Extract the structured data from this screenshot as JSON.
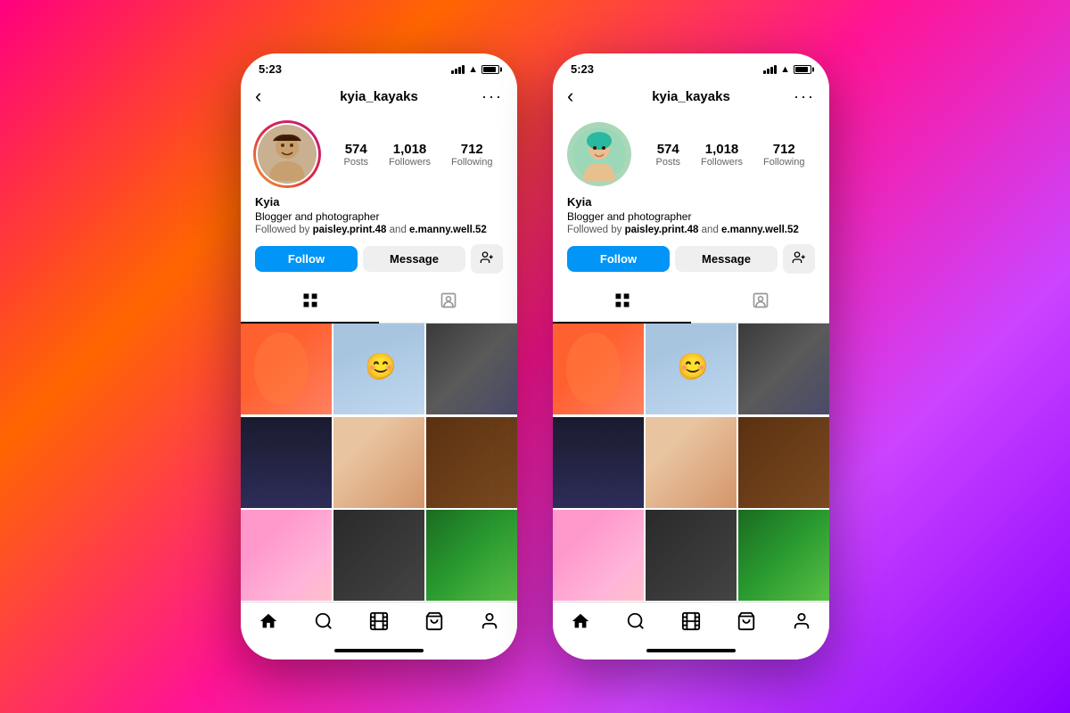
{
  "background": {
    "gradient": "linear-gradient(135deg, #ff0080, #ff6600, #ff1493, #cc44ff, #8800ff)"
  },
  "phones": [
    {
      "id": "phone-1",
      "statusBar": {
        "time": "5:23",
        "hasSignal": true,
        "hasWifi": true,
        "hasBattery": true
      },
      "header": {
        "backLabel": "‹",
        "username": "kyia_kayaks",
        "moreLabel": "···"
      },
      "profile": {
        "name": "Kyia",
        "bio": "Blogger and photographer",
        "followed": "Followed by paisley.print.48 and e.manny.well.52",
        "followedBold1": "paisley.print.48",
        "followedBold2": "e.manny.well.52",
        "stats": [
          {
            "number": "574",
            "label": "Posts"
          },
          {
            "number": "1,018",
            "label": "Followers"
          },
          {
            "number": "712",
            "label": "Following"
          }
        ],
        "avatarType": "real"
      },
      "buttons": {
        "follow": "Follow",
        "message": "Message",
        "addUser": "👤+"
      },
      "tabs": {
        "grid": "⊞",
        "tagged": "👤"
      },
      "photos": [
        "p1",
        "p2",
        "p3",
        "p4",
        "p5",
        "p6",
        "p7",
        "p8",
        "p9"
      ],
      "bottomNav": [
        "🏠",
        "🔍",
        "🎬",
        "🛍",
        "👤"
      ]
    },
    {
      "id": "phone-2",
      "statusBar": {
        "time": "5:23",
        "hasSignal": true,
        "hasWifi": true,
        "hasBattery": true
      },
      "header": {
        "backLabel": "‹",
        "username": "kyia_kayaks",
        "moreLabel": "···"
      },
      "profile": {
        "name": "Kyia",
        "bio": "Blogger and photographer",
        "followed": "Followed by paisley.print.48 and e.manny.well.52",
        "followedBold1": "paisley.print.48",
        "followedBold2": "e.manny.well.52",
        "stats": [
          {
            "number": "574",
            "label": "Posts"
          },
          {
            "number": "1,018",
            "label": "Followers"
          },
          {
            "number": "712",
            "label": "Following"
          }
        ],
        "avatarType": "cartoon"
      },
      "buttons": {
        "follow": "Follow",
        "message": "Message",
        "addUser": "👤+"
      },
      "tabs": {
        "grid": "⊞",
        "tagged": "👤"
      },
      "photos": [
        "p1",
        "p2",
        "p3",
        "p4",
        "p5",
        "p6",
        "p7",
        "p8",
        "p9"
      ],
      "bottomNav": [
        "🏠",
        "🔍",
        "🎬",
        "🛍",
        "👤"
      ]
    }
  ]
}
